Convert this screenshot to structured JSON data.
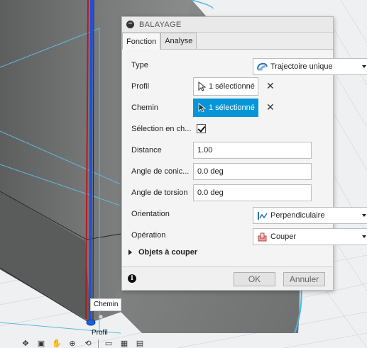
{
  "dialog": {
    "title": "BALAYAGE",
    "tabs": [
      {
        "label": "Fonction",
        "active": true
      },
      {
        "label": "Analyse",
        "active": false
      }
    ],
    "fields": {
      "type": {
        "label": "Type",
        "value": "Trajectoire unique",
        "icon": "sweep-path-icon"
      },
      "profil": {
        "label": "Profil",
        "value": "1 sélectionné",
        "icon": "cursor-arrow-icon"
      },
      "chemin": {
        "label": "Chemin",
        "value": "1 sélectionné",
        "icon": "cursor-arrow-icon",
        "active": true
      },
      "selection_chain": {
        "label": "Sélection en ch...",
        "checked": true
      },
      "distance": {
        "label": "Distance",
        "value": "1.00"
      },
      "conicity": {
        "label": "Angle de conic...",
        "value": "0.0 deg"
      },
      "torsion": {
        "label": "Angle de torsion",
        "value": "0.0 deg"
      },
      "orientation": {
        "label": "Orientation",
        "value": "Perpendiculaire",
        "icon": "perpendicular-icon"
      },
      "operation": {
        "label": "Opération",
        "value": "Couper",
        "icon": "cut-icon"
      }
    },
    "objets_section": {
      "label": "Objets à couper",
      "expanded": false
    },
    "footer": {
      "ok_label": "OK",
      "cancel_label": "Annuler"
    }
  },
  "viewport": {
    "labels": {
      "chemin": "Chemin",
      "profil": "Profil"
    }
  },
  "colors": {
    "accent": "#0696d7",
    "path_red": "#c0141c",
    "path_blue": "#1f4fd8",
    "body_gray": "#707272"
  }
}
